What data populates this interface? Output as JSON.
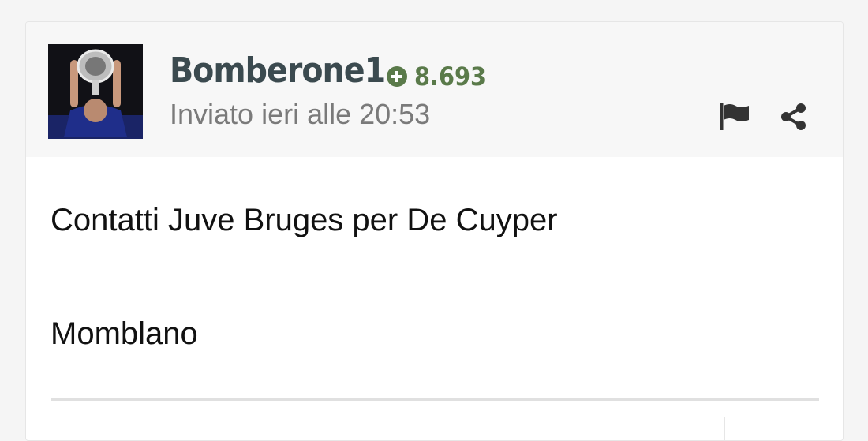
{
  "post": {
    "username": "Bomberone1",
    "reputation": "8.693",
    "posted": "Inviato ieri alle 20:53",
    "lines": [
      "Contatti Juve Bruges per De Cuyper",
      "Momblano"
    ]
  },
  "icons": {
    "reputation": "plus-circle-icon",
    "report": "flag-icon",
    "share": "share-icon"
  },
  "colors": {
    "username": "#3b4a4f",
    "reputation": "#5a7a4a",
    "meta": "#7a7a7a",
    "action_icons": "#333333"
  }
}
